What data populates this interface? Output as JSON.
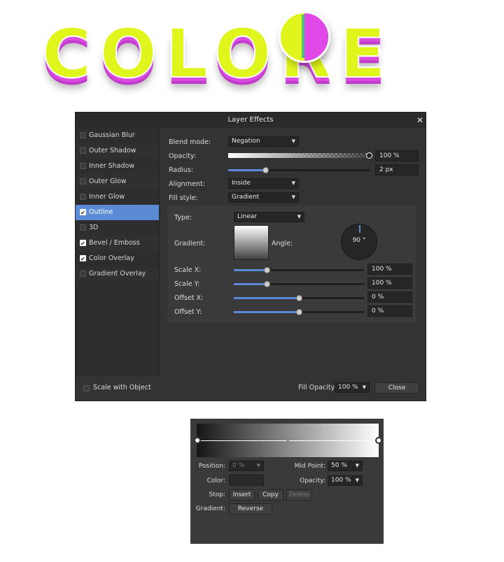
{
  "logo": {
    "text": "COLORE"
  },
  "dialog": {
    "title": "Layer Effects",
    "close_glyph": "✕",
    "effects": [
      {
        "label": "Gaussian Blur",
        "checked": false,
        "selected": false
      },
      {
        "label": "Outer Shadow",
        "checked": false,
        "selected": false
      },
      {
        "label": "Inner Shadow",
        "checked": false,
        "selected": false
      },
      {
        "label": "Outer Glow",
        "checked": false,
        "selected": false
      },
      {
        "label": "Inner Glow",
        "checked": false,
        "selected": false
      },
      {
        "label": "Outline",
        "checked": true,
        "selected": true
      },
      {
        "label": "3D",
        "checked": false,
        "selected": false
      },
      {
        "label": "Bevel / Emboss",
        "checked": true,
        "selected": false
      },
      {
        "label": "Color Overlay",
        "checked": true,
        "selected": false
      },
      {
        "label": "Gradient Overlay",
        "checked": false,
        "selected": false
      }
    ],
    "blend_mode": {
      "label": "Blend mode:",
      "value": "Negation"
    },
    "opacity": {
      "label": "Opacity:",
      "value": "100 %",
      "level": 1.0
    },
    "radius": {
      "label": "Radius:",
      "value": "2 px",
      "level": 0.26
    },
    "alignment": {
      "label": "Alignment:",
      "value": "Inside"
    },
    "fill_style": {
      "label": "Fill style:",
      "value": "Gradient"
    },
    "gradient_settings": {
      "type": {
        "label": "Type:",
        "value": "Linear"
      },
      "gradient_label": "Gradient:",
      "angle": {
        "label": "Angle:",
        "value": "90 °"
      },
      "scale_x": {
        "label": "Scale X:",
        "value": "100 %",
        "level": 0.25
      },
      "scale_y": {
        "label": "Scale Y:",
        "value": "100 %",
        "level": 0.25
      },
      "offset_x": {
        "label": "Offset X:",
        "value": "0 %",
        "level": 0.5
      },
      "offset_y": {
        "label": "Offset Y:",
        "value": "0 %",
        "level": 0.5
      }
    },
    "footer": {
      "scale_with_object": "Scale with Object",
      "fill_opacity_label": "Fill Opacity:",
      "fill_opacity_value": "100 %",
      "close_label": "Close"
    }
  },
  "gradient_editor": {
    "position": {
      "label": "Position:",
      "value": "0 %"
    },
    "mid_point": {
      "label": "Mid Point:",
      "value": "50 %",
      "level": 0.5
    },
    "color": {
      "label": "Color:",
      "value": "#2a2a2a"
    },
    "opacity": {
      "label": "Opacity:",
      "value": "100 %"
    },
    "stop": {
      "label": "Stop:",
      "insert": "Insert",
      "copy": "Copy",
      "delete": "Delete"
    },
    "gradient": {
      "label": "Gradient:",
      "reverse": "Reverse"
    }
  },
  "colors": {
    "accent": "#5b8ad6",
    "logo_yellow": "#dff51c",
    "logo_magenta": "#d94ce0",
    "dialog_bg": "#333333"
  }
}
